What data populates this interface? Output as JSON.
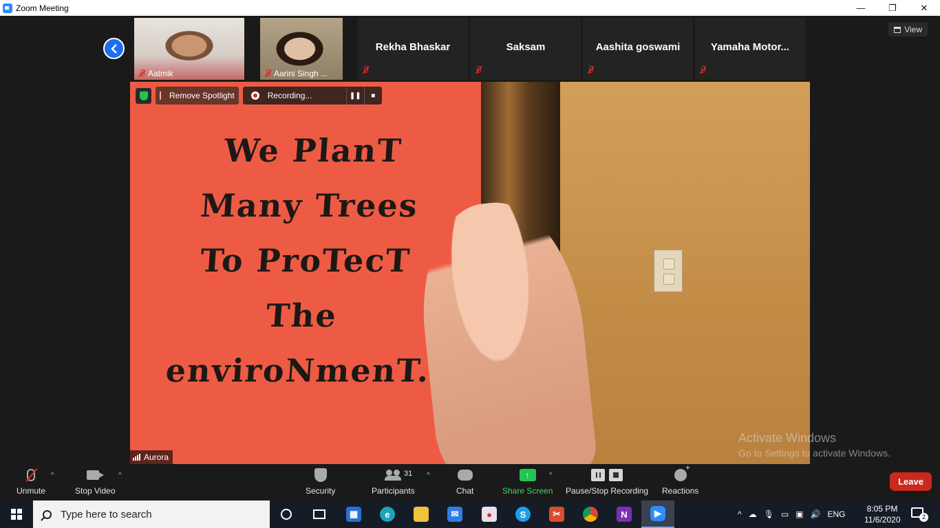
{
  "window": {
    "title": "Zoom Meeting",
    "minimize": "—",
    "restore": "❐",
    "close": "✕"
  },
  "participants_strip": [
    {
      "name": "Aatmik"
    },
    {
      "name": "Aarini Singh ..."
    },
    {
      "name": "Rekha Bhaskar"
    },
    {
      "name": "Saksam"
    },
    {
      "name": "Aashita goswami"
    },
    {
      "name": "Yamaha  Motor..."
    }
  ],
  "view_button": "View",
  "main_video": {
    "poster_text": "We PlanT\nMany Trees\nTo ProTecT\nThe\nenviroNmenT.",
    "remove_spotlight": "Remove Spotlight",
    "recording_label": "Recording...",
    "speaker_name": "Aurora"
  },
  "watermark": {
    "heading": "Activate Windows",
    "subtext": "Go to Settings to activate Windows."
  },
  "toolbar": {
    "unmute": "Unmute",
    "stop_video": "Stop Video",
    "security": "Security",
    "participants": "Participants",
    "participants_count": "31",
    "chat": "Chat",
    "share_screen": "Share Screen",
    "pause_stop_recording": "Pause/Stop Recording",
    "reactions": "Reactions",
    "leave": "Leave"
  },
  "taskbar": {
    "search_placeholder": "Type here to search",
    "language": "ENG",
    "time": "8:05 PM",
    "date": "11/6/2020",
    "notification_count": "2"
  },
  "colors": {
    "accent_blue": "#1d6ef1",
    "share_green": "#23c552",
    "leave_red": "#c9291f",
    "poster_red": "#ee5b45"
  }
}
